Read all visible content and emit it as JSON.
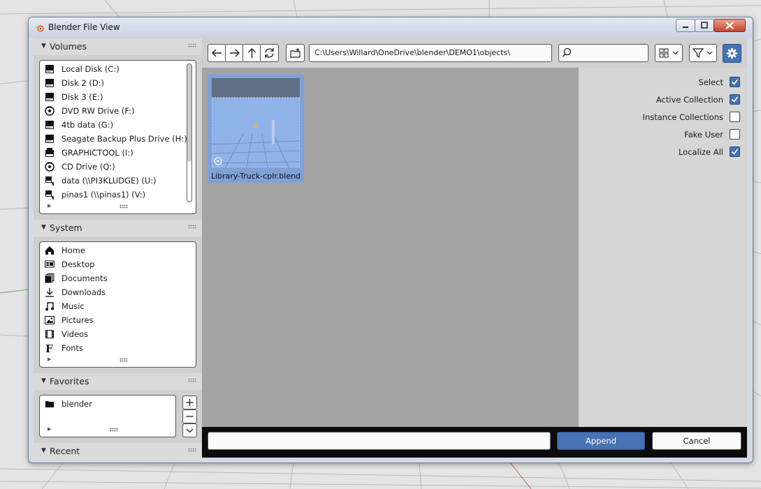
{
  "window": {
    "title": "Blender File View"
  },
  "sections": {
    "volumes": {
      "label": "Volumes",
      "items": [
        {
          "label": "Local Disk (C:)",
          "icon": "disk-icon"
        },
        {
          "label": "Disk 2 (D:)",
          "icon": "disk-icon"
        },
        {
          "label": "Disk 3 (E:)",
          "icon": "disk-icon"
        },
        {
          "label": "DVD RW Drive (F:)",
          "icon": "disc-icon"
        },
        {
          "label": "4tb data (G:)",
          "icon": "disk-icon"
        },
        {
          "label": "Seagate Backup Plus Drive (H:)",
          "icon": "disk-icon"
        },
        {
          "label": "GRAPHICTOOL (I:)",
          "icon": "removable-disk-icon"
        },
        {
          "label": "CD Drive (Q:)",
          "icon": "disc-icon"
        },
        {
          "label": "data (\\\\PI3KLUDGE) (U:)",
          "icon": "network-drive-icon"
        },
        {
          "label": "pinas1 (\\\\pinas1) (V:)",
          "icon": "network-drive-icon"
        }
      ]
    },
    "system": {
      "label": "System",
      "items": [
        {
          "label": "Home",
          "icon": "home-icon"
        },
        {
          "label": "Desktop",
          "icon": "desktop-icon"
        },
        {
          "label": "Documents",
          "icon": "documents-icon"
        },
        {
          "label": "Downloads",
          "icon": "download-icon"
        },
        {
          "label": "Music",
          "icon": "music-icon"
        },
        {
          "label": "Pictures",
          "icon": "picture-icon"
        },
        {
          "label": "Videos",
          "icon": "video-icon"
        },
        {
          "label": "Fonts",
          "icon": "font-icon"
        }
      ]
    },
    "favorites": {
      "label": "Favorites",
      "items": [
        {
          "label": "blender",
          "icon": "folder-icon"
        }
      ]
    },
    "recent": {
      "label": "Recent"
    }
  },
  "toolbar": {
    "path": "C:\\Users\\Willard\\OneDrive\\blender\\DEMO1\\objects\\",
    "search_value": ""
  },
  "files": [
    {
      "name": "Library-Truck-cplr.blend"
    }
  ],
  "options": [
    {
      "label": "Select",
      "checked": true
    },
    {
      "label": "Active Collection",
      "checked": true
    },
    {
      "label": "Instance Collections",
      "checked": false
    },
    {
      "label": "Fake User",
      "checked": false
    },
    {
      "label": "Localize All",
      "checked": true
    }
  ],
  "footer": {
    "filename_value": "",
    "append_label": "Append",
    "cancel_label": "Cancel"
  },
  "colors": {
    "accent": "#4772b3",
    "panel": "#d0d0d0",
    "file_area": "#a4a4a4"
  }
}
